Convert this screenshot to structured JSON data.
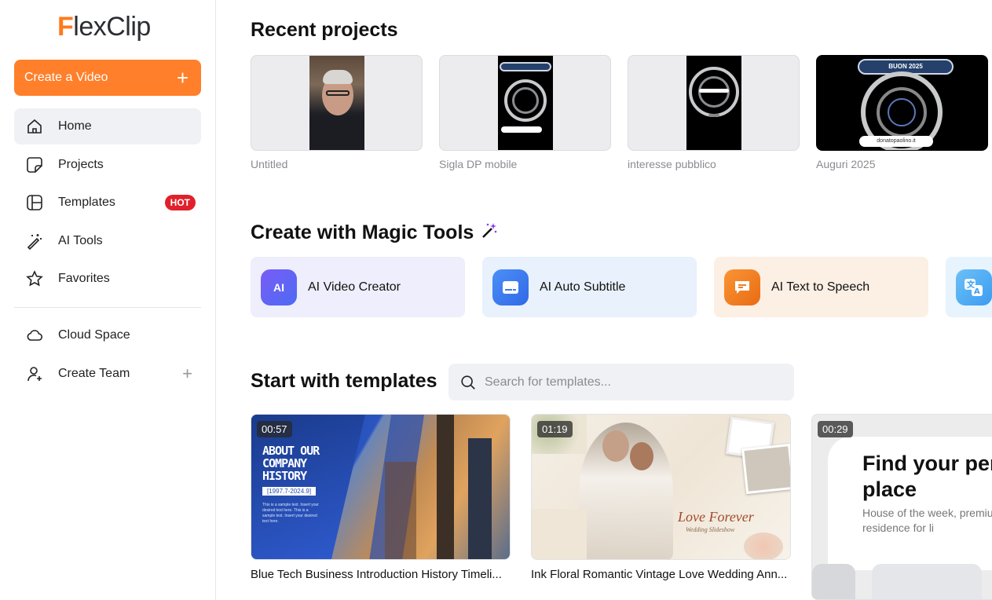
{
  "app": {
    "logo_text": "FlexClip"
  },
  "sidebar": {
    "create_label": "Create a Video",
    "items": [
      {
        "label": "Home",
        "icon": "home-icon"
      },
      {
        "label": "Projects",
        "icon": "projects-icon"
      },
      {
        "label": "Templates",
        "icon": "templates-icon",
        "badge": "HOT"
      },
      {
        "label": "AI Tools",
        "icon": "magic-wand-icon"
      },
      {
        "label": "Favorites",
        "icon": "star-icon"
      }
    ],
    "bottom_items": [
      {
        "label": "Cloud Space",
        "icon": "cloud-icon"
      },
      {
        "label": "Create Team",
        "icon": "add-user-icon"
      }
    ]
  },
  "recent": {
    "title": "Recent projects",
    "projects": [
      {
        "name": "Untitled"
      },
      {
        "name": "Sigla DP mobile"
      },
      {
        "name": "interesse pubblico"
      },
      {
        "name": "Auguri 2025",
        "banner": "BUON 2025",
        "url": "donatopaolino.it"
      }
    ]
  },
  "magic": {
    "title": "Create with Magic Tools",
    "tools": [
      {
        "label": "AI Video Creator",
        "icon_text": "AI",
        "color": "#5b5cf0",
        "bg": "#eeeefc"
      },
      {
        "label": "AI Auto Subtitle",
        "color": "#3f7ef5",
        "bg": "#e8f1fc"
      },
      {
        "label": "AI Text to Speech",
        "color": "#f47d1e",
        "bg": "#fcefe4"
      },
      {
        "label": "",
        "color": "#4fa9f2",
        "bg": "#e7f4fd"
      }
    ]
  },
  "templates": {
    "title": "Start with templates",
    "search_placeholder": "Search for templates...",
    "items": [
      {
        "duration": "00:57",
        "name": "Blue Tech Business Introduction History Timeli...",
        "thumb_title": "ABOUT OUR COMPANY HISTORY",
        "thumb_years": "[1997.7-2024.9]",
        "thumb_body": "This is a sample text. Insert your desired text here. This is a sample text. Insert your desired text here."
      },
      {
        "duration": "01:19",
        "name": "Ink Floral Romantic Vintage Love Wedding Ann...",
        "thumb_title": "Love Forever",
        "thumb_sub": "Wedding Slideshow"
      },
      {
        "duration": "00:29",
        "name": "",
        "thumb_title": "Find your perfect place",
        "thumb_sub": "House of the week, premium residence for li"
      }
    ]
  }
}
